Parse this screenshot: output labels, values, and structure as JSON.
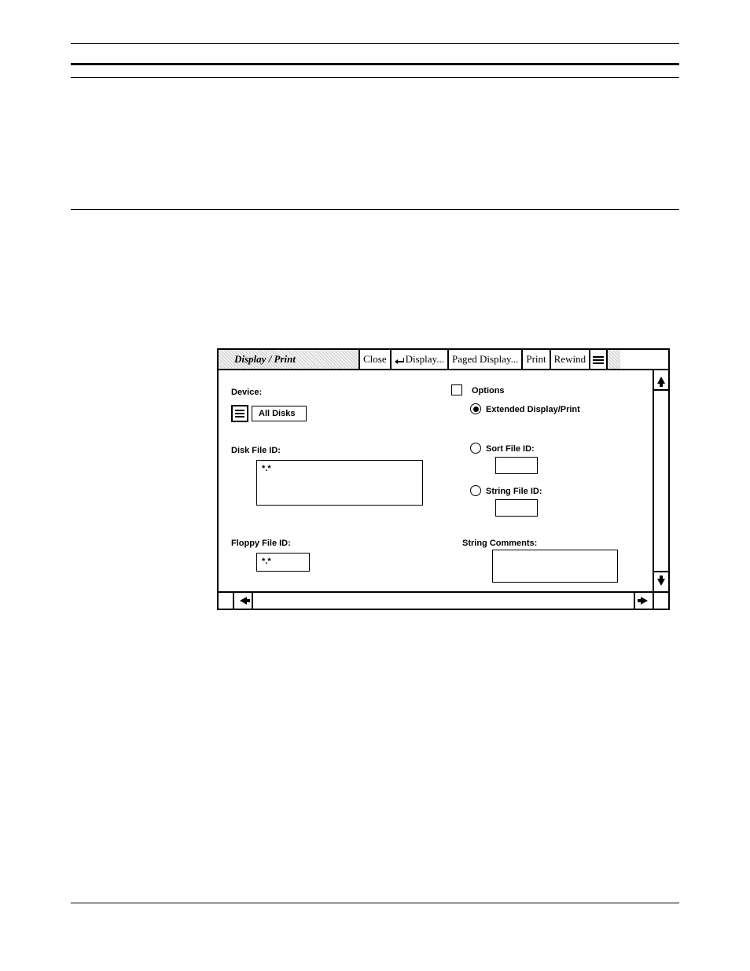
{
  "window": {
    "title": "Display /  Print",
    "buttons": {
      "close": "Close",
      "display": "Display...",
      "paged_display": "Paged Display...",
      "print": "Print",
      "rewind": "Rewind"
    }
  },
  "left": {
    "device_label": "Device:",
    "device_value": "All Disks",
    "disk_file_id_label": "Disk File ID:",
    "disk_file_id_value": "*.*",
    "floppy_file_id_label": "Floppy File ID:",
    "floppy_file_id_value": "*.*"
  },
  "right": {
    "options_label": "Options",
    "extended_label": "Extended Display/Print",
    "sort_file_id_label": "Sort File ID:",
    "string_file_id_label": "String File ID:",
    "string_comments_label": "String Comments:"
  }
}
